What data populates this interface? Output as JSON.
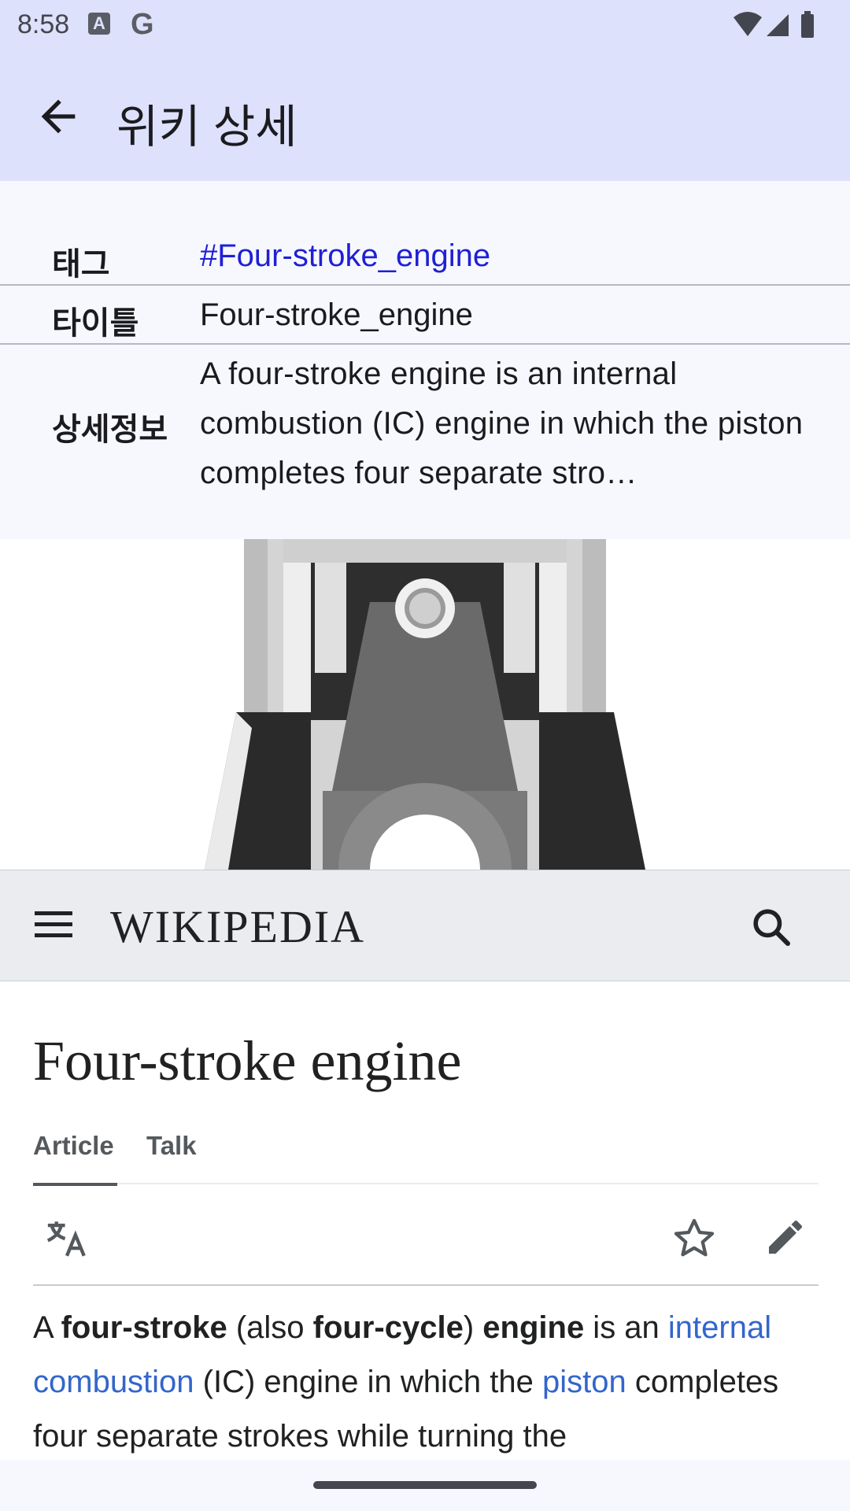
{
  "status_bar": {
    "time": "8:58",
    "icons": [
      "a-notification-icon",
      "google-icon",
      "wifi-icon",
      "signal-icon",
      "battery-icon"
    ]
  },
  "app_bar": {
    "title": "위키 상세",
    "back_icon": "arrow-back-icon"
  },
  "info": {
    "tag_label": "태그",
    "tag_value": "#Four-stroke_engine",
    "title_label": "타이틀",
    "title_value": "Four-stroke_engine",
    "detail_label": "상세정보",
    "detail_value": "A four-stroke engine is an internal combustion (IC) engine in which the piston completes four separate stro…"
  },
  "wiki": {
    "logo": "WIKIPEDIA",
    "menu_icon": "hamburger-menu-icon",
    "search_icon": "search-icon",
    "article_title": "Four-stroke engine",
    "tabs": [
      "Article",
      "Talk"
    ],
    "actions": [
      "translate-icon",
      "star-icon",
      "edit-icon"
    ],
    "text": {
      "p1": "A ",
      "b1": "four-stroke",
      "p2": " (also ",
      "b2": "four-cycle",
      "p3": ") ",
      "b3": "engine",
      "p4": " is an ",
      "link1": "internal combustion",
      "p5": " (IC) engine in which the ",
      "link2": "piston",
      "p6": " completes four separate strokes while turning the"
    }
  },
  "colors": {
    "app_bar_bg": "#dde1fb",
    "link": "#3366cc",
    "tag_link": "#1f1fd6"
  }
}
